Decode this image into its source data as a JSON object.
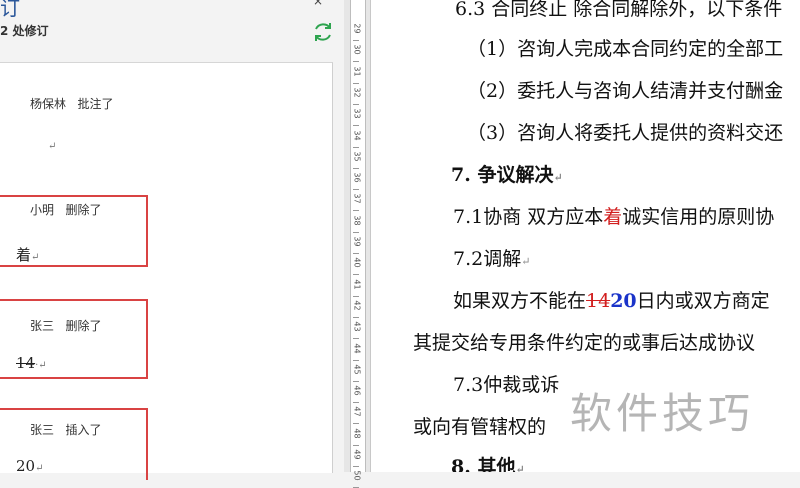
{
  "pane": {
    "title_fragment": "订",
    "revision_count": "2 处修订",
    "close_glyph": "×",
    "items": [
      {
        "author": "杨保林",
        "action": "批注了",
        "text": ""
      },
      {
        "author": "小明",
        "action": "删除了",
        "text": "着"
      },
      {
        "author": "张三",
        "action": "删除了",
        "text": "14"
      },
      {
        "author": "张三",
        "action": "插入了",
        "text": "20"
      }
    ],
    "para_mark": "↵"
  },
  "ruler": {
    "numbers": [
      "29",
      "30",
      "31",
      "32",
      "33",
      "34",
      "35",
      "36",
      "37",
      "38",
      "39",
      "40",
      "41",
      "42",
      "43",
      "44",
      "45",
      "46",
      "47",
      "48",
      "49",
      "50"
    ]
  },
  "doc": {
    "line1": "6.3 合同终止  除合同解除外，以下条件",
    "line2": "（1）咨询人完成本合同约定的全部工",
    "line3": "（2）委托人与咨询人结清并支付酬金",
    "line4": "（3）咨询人将委托人提供的资料交还",
    "h7": "7. 争议解决",
    "l71_pre": "7.1协商 双方应本",
    "l71_red": "着",
    "l71_post": "诚实信用的原则协",
    "l72": "7.2调解",
    "l72b_pre": "如果双方不能在",
    "l72b_del": "14",
    "l72b_ins": "20",
    "l72b_post": "日内或双方商定",
    "l72c": "其提交给专用条件约定的或事后达成协议",
    "l73": "7.3仲裁或诉",
    "l73b": "或向有管辖权的",
    "h8": "8. 其他"
  },
  "watermark": "软件技巧"
}
